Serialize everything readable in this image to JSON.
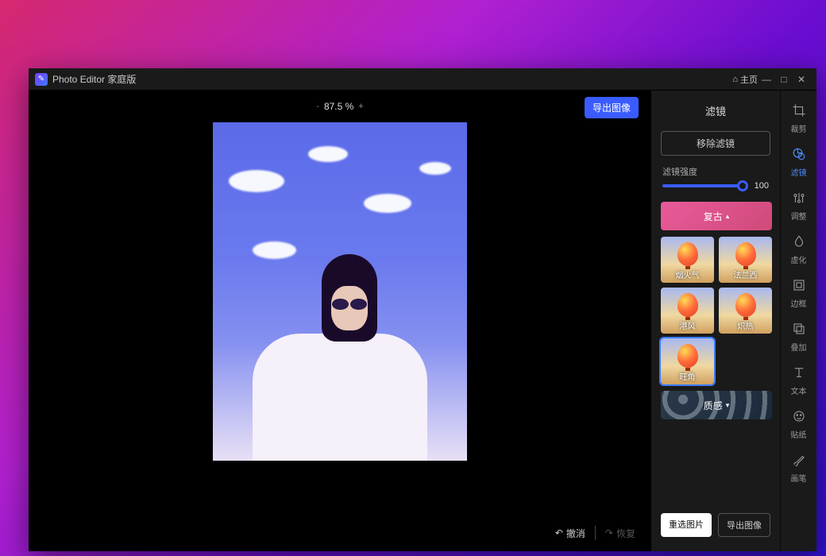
{
  "titlebar": {
    "app_title": "Photo Editor 家庭版",
    "home_label": "主页"
  },
  "canvas": {
    "zoom_percent": "87.5 %",
    "export_label": "导出图像",
    "undo_label": "撤消",
    "redo_label": "恢复"
  },
  "panel": {
    "title": "滤镜",
    "remove_filter": "移除滤镜",
    "intensity_label": "滤镜强度",
    "intensity_value": "100",
    "reselect_btn": "重选图片",
    "export_btn": "导出图像",
    "categories": {
      "retro": "复古",
      "texture": "质感"
    },
    "filters": [
      {
        "label": "烟火气"
      },
      {
        "label": "法兰西"
      },
      {
        "label": "港风"
      },
      {
        "label": "炽热"
      },
      {
        "label": "旺角"
      }
    ],
    "selected_filter_index": 4
  },
  "tools": [
    {
      "key": "crop",
      "label": "裁剪"
    },
    {
      "key": "filter",
      "label": "滤镜"
    },
    {
      "key": "adjust",
      "label": "调整"
    },
    {
      "key": "blur",
      "label": "虚化"
    },
    {
      "key": "frame",
      "label": "边框"
    },
    {
      "key": "overlay",
      "label": "叠加"
    },
    {
      "key": "text",
      "label": "文本"
    },
    {
      "key": "sticker",
      "label": "贴纸"
    },
    {
      "key": "brush",
      "label": "画笔"
    }
  ],
  "active_tool": "filter"
}
